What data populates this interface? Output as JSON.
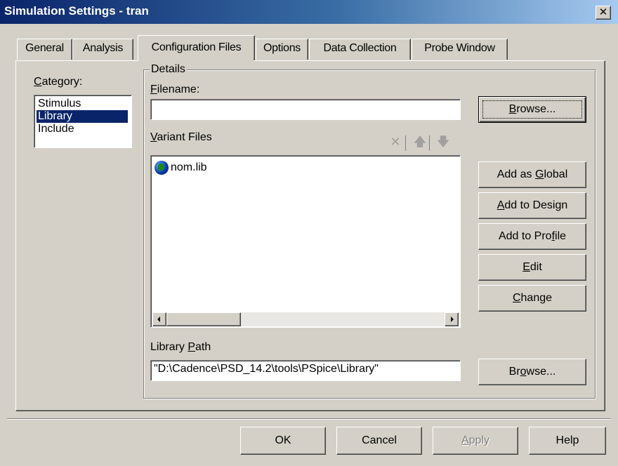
{
  "window": {
    "title": "Simulation Settings - tran",
    "close_glyph": "✕"
  },
  "tabs": [
    {
      "label": "General",
      "active": false
    },
    {
      "label": "Analysis",
      "active": false
    },
    {
      "label": "Configuration Files",
      "active": true
    },
    {
      "label": "Options",
      "active": false
    },
    {
      "label": "Data Collection",
      "active": false
    },
    {
      "label": "Probe Window",
      "active": false
    }
  ],
  "category": {
    "label_pre": "",
    "label_mnemonic": "C",
    "label_post": "ategory:",
    "items": [
      "Stimulus",
      "Library",
      "Include"
    ],
    "selected": "Library"
  },
  "details": {
    "group_label": "Details",
    "filename_mnemonic": "F",
    "filename_rest": "ilename:",
    "filename_value": "",
    "browse_pre": "",
    "browse_mnemonic": "B",
    "browse_post": "rowse...",
    "variant_mnemonic": "V",
    "variant_rest": "ariant Files",
    "files": [
      {
        "name": "nom.lib",
        "icon": "globe-icon"
      }
    ],
    "library_path_pre": "Library ",
    "library_path_mnemonic": "P",
    "library_path_post": "ath",
    "library_path_value": "\"D:\\Cadence\\PSD_14.2\\tools\\PSpice\\Library\"",
    "browse2_pre": "Br",
    "browse2_mnemonic": "o",
    "browse2_post": "wse..."
  },
  "toolbar": {
    "delete_icon": "delete-icon",
    "up_icon": "move-up-icon",
    "down_icon": "move-down-icon"
  },
  "side_buttons": {
    "global": {
      "pre": "Add as ",
      "mn": "G",
      "post": "lobal"
    },
    "design": {
      "pre": "",
      "mn": "A",
      "post": "dd to Design"
    },
    "profile": {
      "pre": "Add to Pro",
      "mn": "f",
      "post": "ile"
    },
    "edit": {
      "pre": "",
      "mn": "E",
      "post": "dit"
    },
    "change": {
      "pre": "",
      "mn": "C",
      "post": "hange"
    }
  },
  "footer": {
    "ok": "OK",
    "cancel": "Cancel",
    "apply_mn": "A",
    "apply_rest": "pply",
    "help": "Help"
  },
  "colors": {
    "title_bar": "#0a246a",
    "selection": "#0a246a",
    "face": "#d4d0c8"
  }
}
